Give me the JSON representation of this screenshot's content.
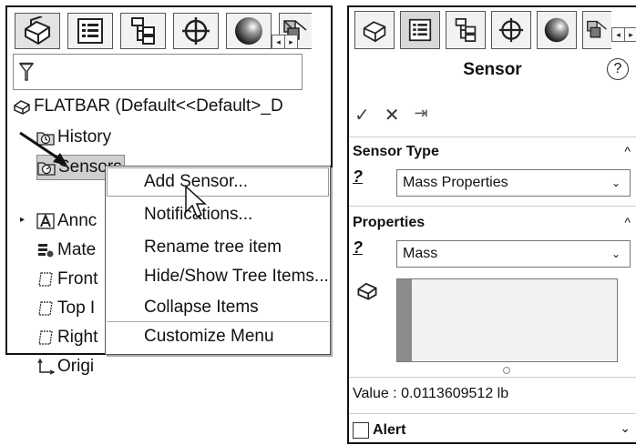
{
  "left_panel": {
    "tabs": [
      "feature-manager-icon",
      "property-manager-icon",
      "configuration-manager-icon",
      "dimxpert-icon",
      "display-manager-icon",
      "sensors-tab-icon"
    ],
    "scroll_left": "◂",
    "scroll_right": "▸",
    "filter_icon": "filter-icon",
    "tree": {
      "root": "FLATBAR  (Default<<Default>_D",
      "items": [
        "History",
        "Sensors",
        "Annc",
        "Mate",
        "Front",
        "Top I",
        "Right",
        "Origi"
      ]
    },
    "context_menu": {
      "items": [
        "Add Sensor...",
        "Notifications...",
        "Rename tree item",
        "Hide/Show Tree Items...",
        "Collapse Items",
        "Customize Menu"
      ]
    }
  },
  "right_panel": {
    "title": "Sensor",
    "help": "?",
    "actions": [
      "✓",
      "✕",
      "⇥"
    ],
    "sensor_type": {
      "header": "Sensor Type",
      "selected": "Mass Properties",
      "help_mark": "?"
    },
    "properties": {
      "header": "Properties",
      "selected": "Mass",
      "help_mark": "?"
    },
    "value": "Value : 0.0113609512 lb",
    "alert": "Alert",
    "caret_up": "^",
    "caret_down": "⌄",
    "chevron": "⌄"
  }
}
